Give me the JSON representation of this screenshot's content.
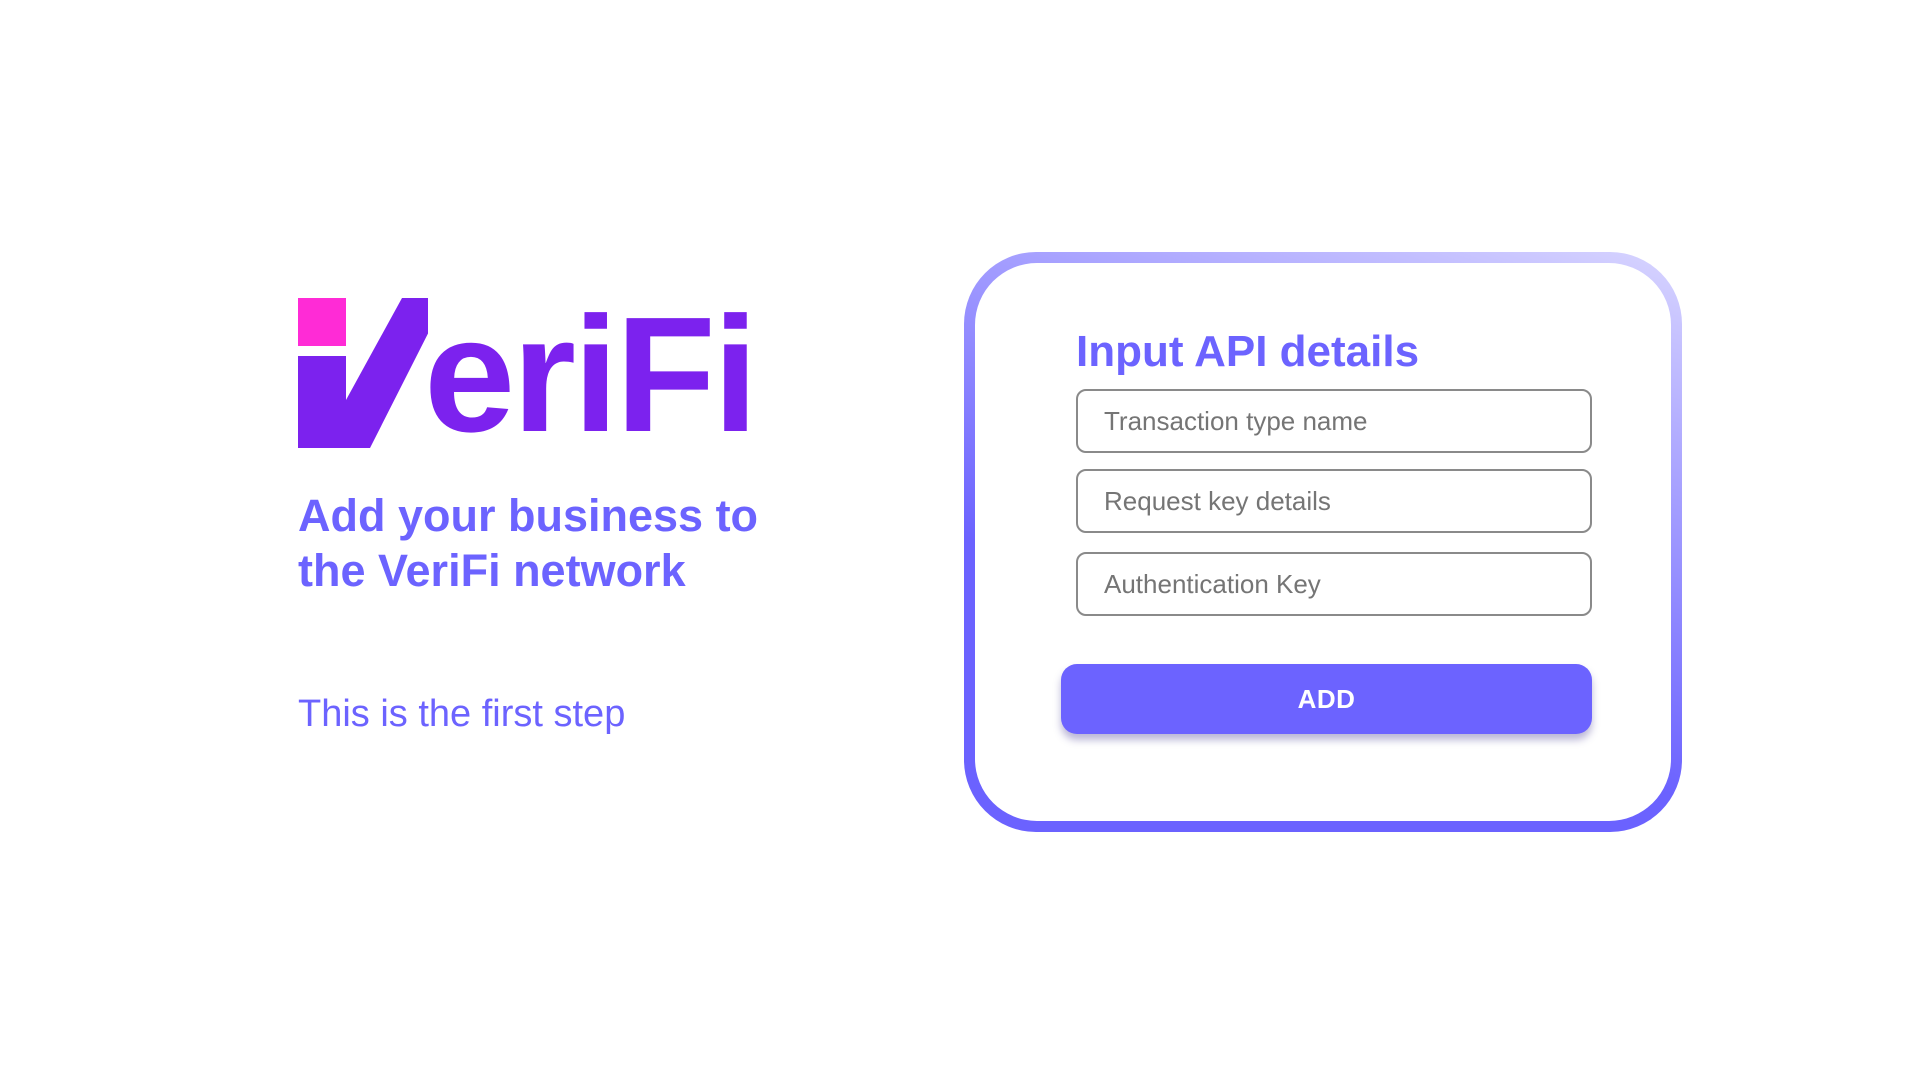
{
  "brand": {
    "logo_text": "VeriFi",
    "logo_v_letter": "V",
    "logo_rest": "eriFi",
    "colors": {
      "logo_purple": "#7c22ee",
      "logo_pink": "#ff2bd6",
      "accent": "#6c63ff"
    }
  },
  "left": {
    "headline_line1": "Add your business to",
    "headline_line2": "the VeriFi network",
    "subline": "This is the first step"
  },
  "form": {
    "title": "Input API details",
    "fields": [
      {
        "placeholder": "Transaction type name",
        "value": ""
      },
      {
        "placeholder": "Request key details",
        "value": ""
      },
      {
        "placeholder": "Authentication Key",
        "value": ""
      }
    ],
    "submit_label": "ADD"
  }
}
